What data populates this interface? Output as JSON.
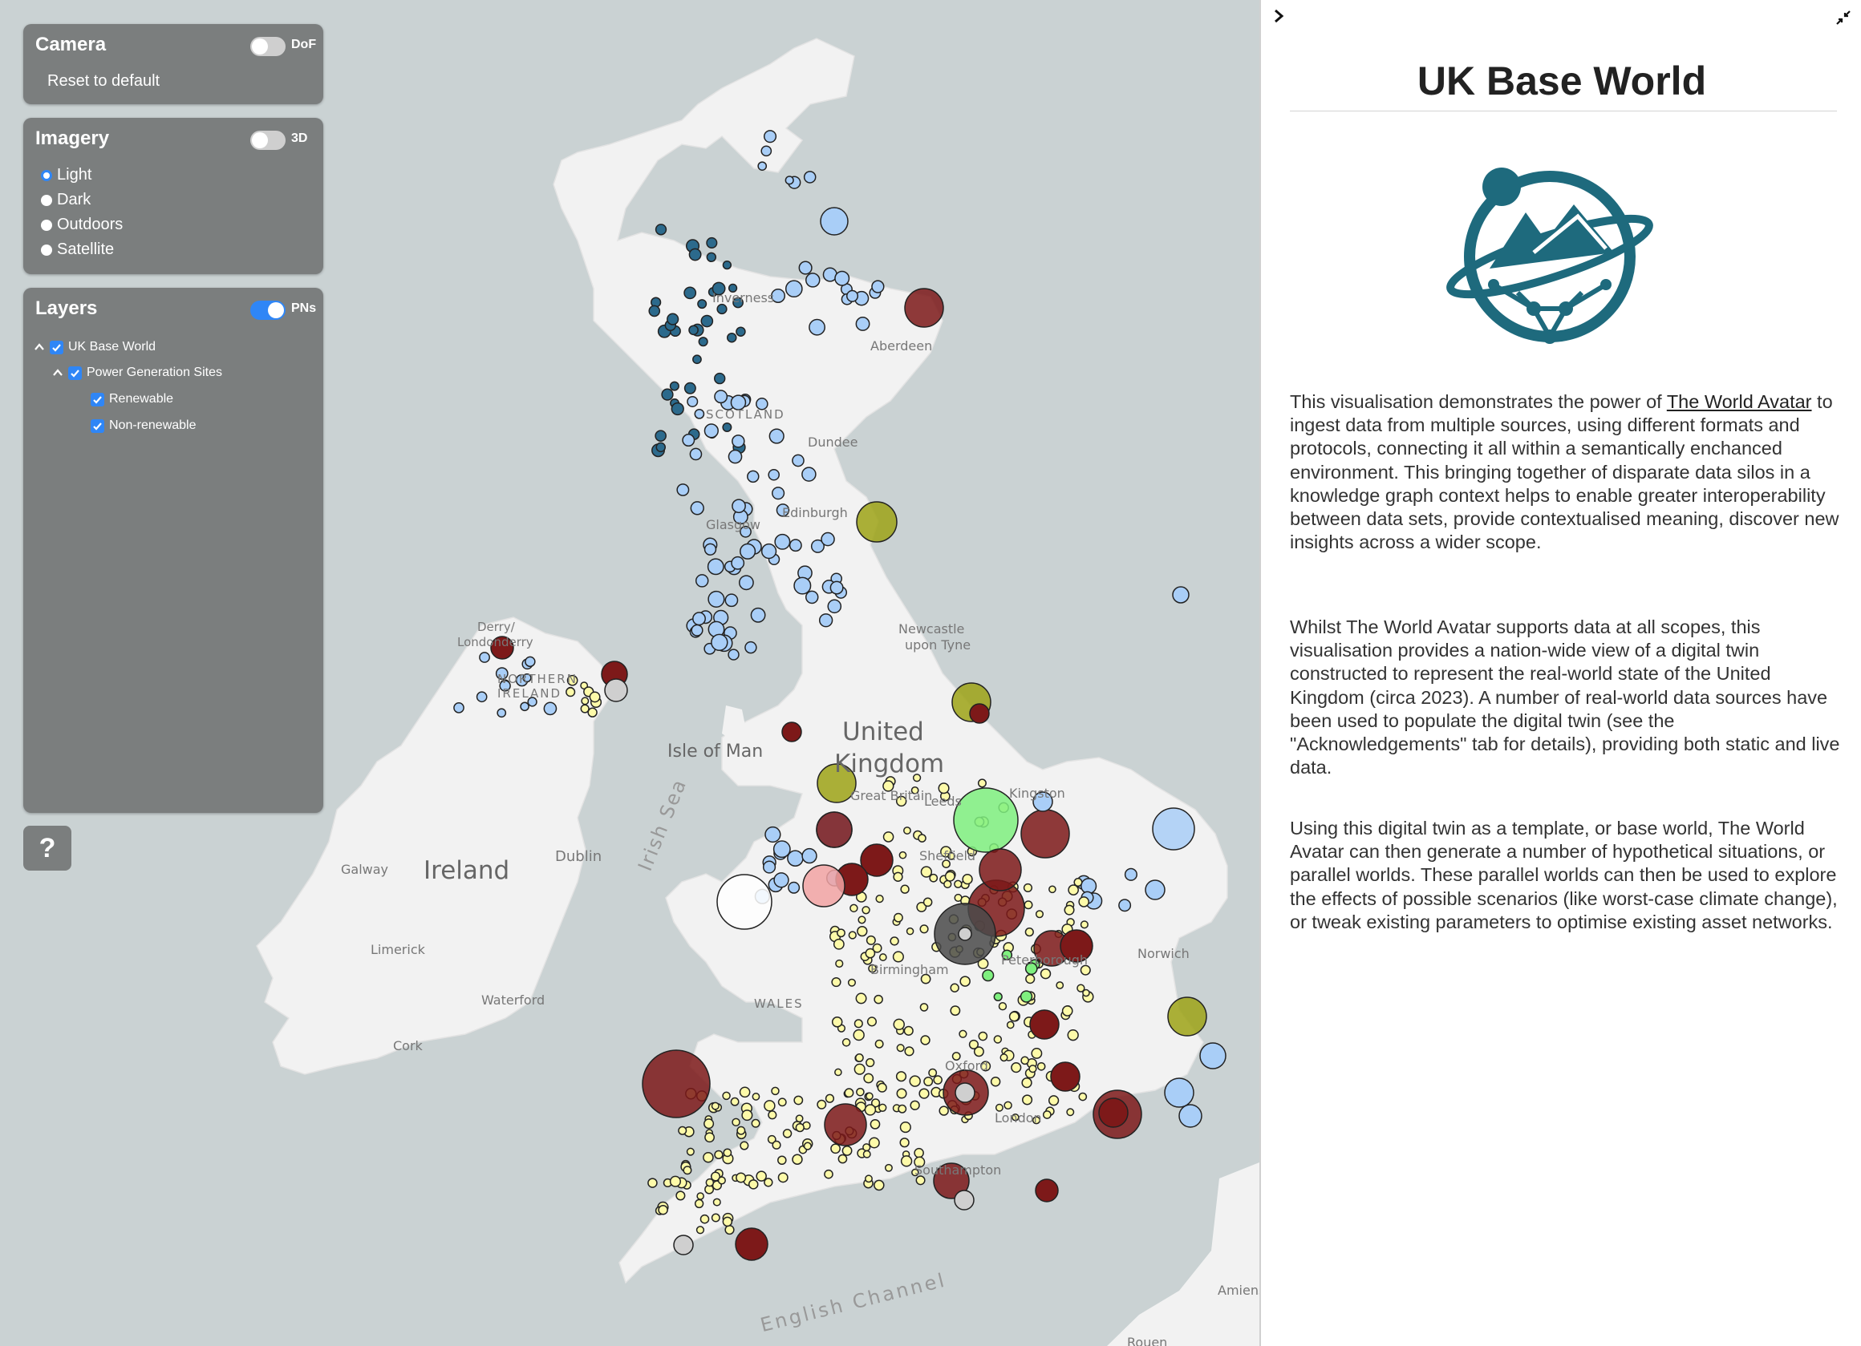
{
  "camera": {
    "title": "Camera",
    "dof_label": "DoF",
    "dof_on": false,
    "reset_label": "Reset to default"
  },
  "imagery": {
    "title": "Imagery",
    "toggle_3d_label": "3D",
    "toggle_3d_on": false,
    "options": [
      "Light",
      "Dark",
      "Outdoors",
      "Satellite"
    ],
    "selected": "Light"
  },
  "layers": {
    "title": "Layers",
    "pns_label": "PNs",
    "pns_on": true,
    "tree": [
      {
        "label": "UK Base World",
        "checked": true,
        "expanded": true
      },
      {
        "label": "Power Generation Sites",
        "checked": true,
        "expanded": true
      },
      {
        "label": "Renewable",
        "checked": true
      },
      {
        "label": "Non-renewable",
        "checked": true
      }
    ]
  },
  "help_label": "?",
  "map": {
    "labels": {
      "united": "United",
      "kingdom": "Kingdom",
      "ireland": "Ireland",
      "isle_of_man": "Isle of Man",
      "irish_sea": "Irish Sea",
      "english_channel": "English Channel",
      "dublin": "Dublin",
      "galway": "Galway",
      "limerick": "Limerick",
      "waterford": "Waterford",
      "cork": "Cork",
      "scotland": "SCOTLAND",
      "northern_ireland_1": "NORTHERN",
      "northern_ireland_2": "IRELAND",
      "wales": "WALES",
      "glasgow": "Glasgow",
      "edinburgh": "Edinburgh",
      "dundee": "Dundee",
      "aberdeen": "Aberdeen",
      "inverness": "Inverness",
      "derry": "Derry/",
      "londonderry": "Londonderry",
      "newcastle_1": "Newcastle",
      "newcastle_2": "upon Tyne",
      "leeds": "Leeds",
      "sheffield": "Sheffield",
      "birmingham": "Birmingham",
      "london": "London",
      "southampton": "Southampton",
      "peterborough": "Peterborough",
      "oxford": "Oxford",
      "norwich": "Norwich",
      "kingston": "Kingston",
      "great_britain": "Great Britain",
      "amiens": "Amiens",
      "rouen": "Rouen"
    },
    "colors": {
      "water": "#cad2d3",
      "land": "#f2f2f2",
      "solar": "#fdfaa9",
      "wind_onshore": "#a9cef7",
      "wind_offshore": "#2c6a8c",
      "gas": "#7d1919",
      "nuclear": "#9ea316",
      "coal": "#4a4a4a",
      "biomass": "#7ff07f",
      "other": "#d6d6d6"
    }
  },
  "sidebar": {
    "expand_icon": "chevron-right-icon",
    "collapse_icon": "minimize-arrows-icon",
    "title": "UK Base World",
    "logo_icon": "world-avatar-logo",
    "logo_color": "#1e6a7d",
    "p1_before": "This visualisation demonstrates the power of ",
    "p1_link": "The World Avatar",
    "p1_after": " to ingest data from multiple sources, using different formats and protocols, connecting it all within a semantically enchanced environment. This bringing together of disparate data silos in a knowledge graph context helps to enable greater interoperability between data sets, provide contextualised meaning, discover new insights across a wider scope.",
    "p2": "Whilst The World Avatar supports data at all scopes, this visualisation provides a nation-wide view of a digital twin constructed to represent the real-world state of the United Kingdom (circa 2023). A number of real-world data sources have been used to populate the digital twin (see the \"Acknowledgements\" tab for details), providing both static and live data.",
    "p3": "Using this digital twin as a template, or base world, The World Avatar can then generate a number of hypothetical situations, or parallel worlds. These parallel worlds can then be used to explore the effects of possible scenarios (like worst-case climate change), or tweak existing parameters to optimise existing asset networks."
  }
}
